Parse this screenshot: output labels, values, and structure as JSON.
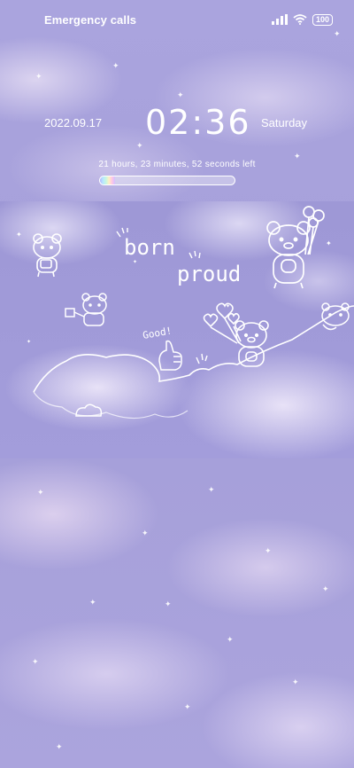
{
  "status_bar": {
    "carrier": "Emergency calls",
    "battery": "100",
    "icons": [
      "signal-icon",
      "wifi-icon",
      "battery-icon"
    ]
  },
  "clock": {
    "date": "2022.09.17",
    "time": "02:36",
    "weekday": "Saturday",
    "countdown": "21 hours, 23 minutes, 52 seconds left",
    "day_progress": 0.11
  },
  "banner": {
    "line1": "born",
    "line2": "proud",
    "caption": "Good!"
  },
  "colors": {
    "background": "#a9a3dc",
    "text": "#ffffff"
  }
}
